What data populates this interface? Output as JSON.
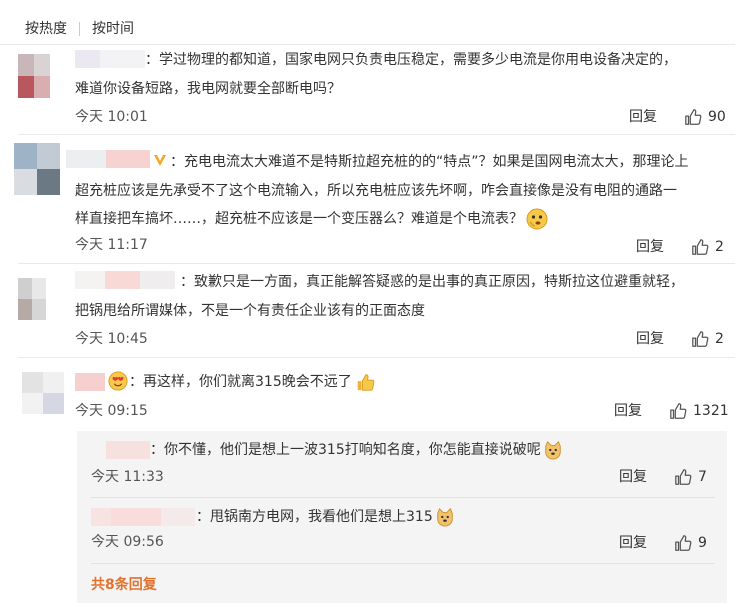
{
  "sort": {
    "by_hot": "按热度",
    "by_time": "按时间"
  },
  "comments": [
    {
      "text": "：学过物理的都知道，国家电网只负责电压稳定，需要多少电流是你用电设备决定的，难道你设备短路，我电网就要全部断电吗？",
      "text_line1": "：学过物理的都知道，国家电网只负责电压稳定，需要多少电流是你用电设备决定的，",
      "text_line2": "难道你设备短路，我电网就要全部断电吗？",
      "time": "今天 10:01",
      "reply": "回复",
      "likes": "90"
    },
    {
      "text_line1": "：充电电流太大难道不是特斯拉超充桩的的“特点”？如果是国网电流太大，那理论上",
      "text_line2": "超充桩应该是先承受不了这个电流输入，所以充电桩应该先坏啊，咋会直接像是没有电阻的通路一",
      "text_line3": "样直接把车搞坏……，超充桩不应该是一个变压器么？难道是个电流表？",
      "time": "今天 11:17",
      "reply": "回复",
      "likes": "2"
    },
    {
      "text_line1": "：致歉只是一方面，真正能解答疑惑的是出事的真正原因，特斯拉这位避重就轻，",
      "text_line2": "把锅甩给所谓媒体，不是一个有责任企业该有的正面态度",
      "time": "今天 10:45",
      "reply": "回复",
      "likes": "2"
    },
    {
      "text_line1": "：再这样，你们就离315晚会不远了",
      "time": "今天 09:15",
      "reply": "回复",
      "likes": "1321",
      "replies": [
        {
          "text": "：你不懂，他们是想上一波315打响知名度，你怎能直接说破呢",
          "time": "今天 11:33",
          "reply": "回复",
          "likes": "7"
        },
        {
          "text": "：甩锅南方电网，我看他们是想上315",
          "time": "今天 09:56",
          "reply": "回复",
          "likes": "9"
        }
      ],
      "total_replies": "共8条回复"
    }
  ],
  "colors": {
    "accent": "#e3722d",
    "vip_badge": "#f5a623",
    "text": "#333333",
    "divider": "#e9e9e9",
    "nested_bg": "#f4f4f5"
  }
}
